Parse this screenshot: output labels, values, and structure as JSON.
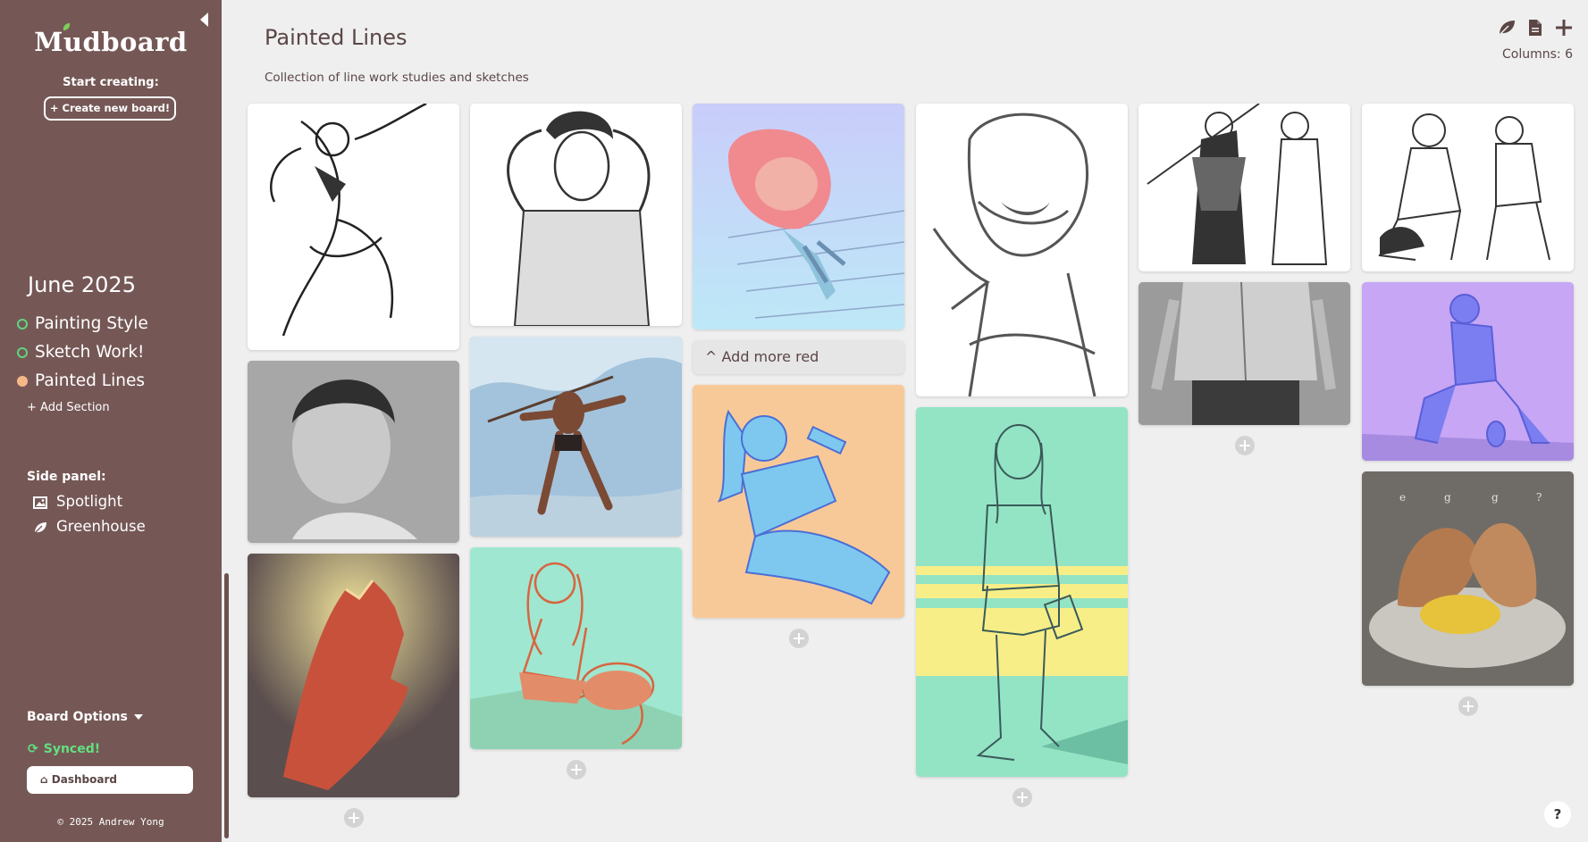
{
  "sidebar": {
    "app_name": "Mudboard",
    "start_label": "Start creating:",
    "create_button": "+ Create new board!",
    "month": "June 2025",
    "sections": [
      {
        "label": "Painting Style",
        "active": false
      },
      {
        "label": "Sketch Work!",
        "active": false
      },
      {
        "label": "Painted Lines",
        "active": true
      }
    ],
    "add_section": "+ Add Section",
    "side_panel_label": "Side panel:",
    "panel_items": [
      {
        "label": "Spotlight",
        "icon": "image-icon"
      },
      {
        "label": "Greenhouse",
        "icon": "leaf-icon"
      }
    ],
    "board_options": "Board Options",
    "sync_status": "Synced!",
    "dashboard_button": "Dashboard",
    "copyright": "© 2025 Andrew Yong"
  },
  "header": {
    "title": "Painted Lines",
    "subtitle": "Collection of line work studies and sketches",
    "columns_label": "Columns: 6",
    "icons": [
      "leaf-icon",
      "file-icon",
      "plus-icon"
    ]
  },
  "board": {
    "note": "^ Add more red",
    "help": "?"
  },
  "colors": {
    "sidebar_bg": "#755856",
    "page_bg": "#efefef",
    "synced_green": "#62e07f",
    "active_section_dot": "#f5b988",
    "inactive_section_ring": "#62d47f"
  }
}
